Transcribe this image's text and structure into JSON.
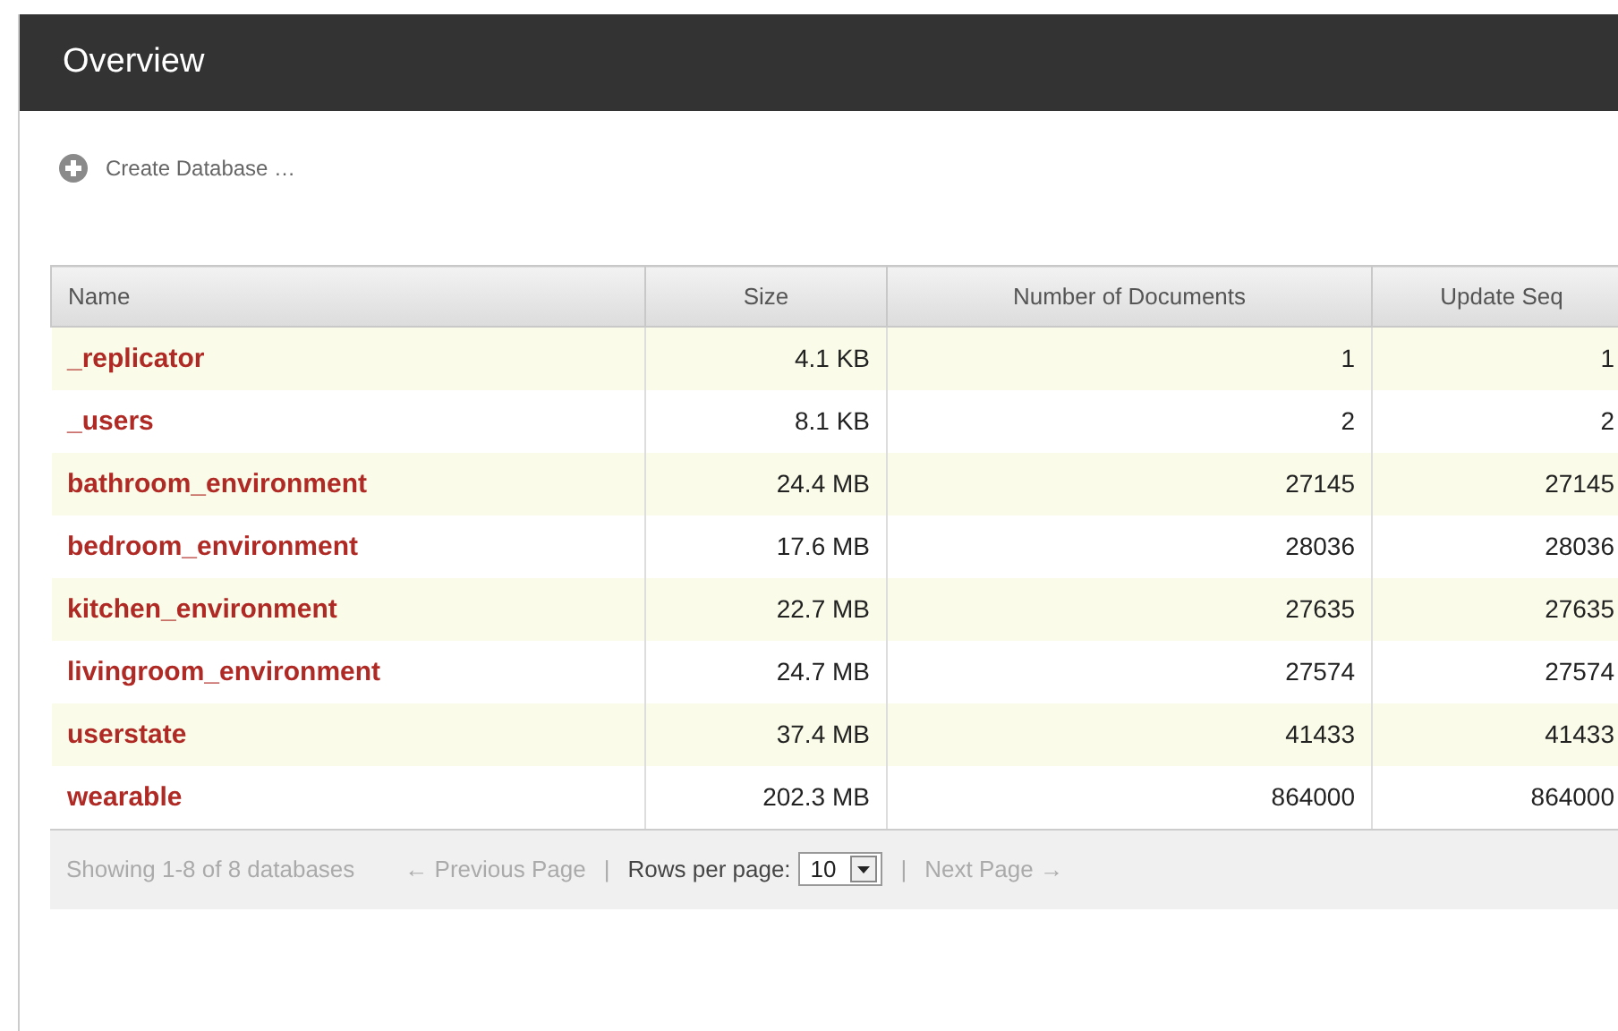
{
  "header": {
    "title": "Overview"
  },
  "create_link": {
    "label": "Create Database …"
  },
  "table": {
    "columns": [
      "Name",
      "Size",
      "Number of Documents",
      "Update Seq"
    ],
    "rows": [
      {
        "name": "_replicator",
        "size": "4.1 KB",
        "docs": "1",
        "seq": "1"
      },
      {
        "name": "_users",
        "size": "8.1 KB",
        "docs": "2",
        "seq": "2"
      },
      {
        "name": "bathroom_environment",
        "size": "24.4 MB",
        "docs": "27145",
        "seq": "27145"
      },
      {
        "name": "bedroom_environment",
        "size": "17.6 MB",
        "docs": "28036",
        "seq": "28036"
      },
      {
        "name": "kitchen_environment",
        "size": "22.7 MB",
        "docs": "27635",
        "seq": "27635"
      },
      {
        "name": "livingroom_environment",
        "size": "24.7 MB",
        "docs": "27574",
        "seq": "27574"
      },
      {
        "name": "userstate",
        "size": "37.4 MB",
        "docs": "41433",
        "seq": "41433"
      },
      {
        "name": "wearable",
        "size": "202.3 MB",
        "docs": "864000",
        "seq": "864000"
      }
    ]
  },
  "footer": {
    "summary": "Showing 1-8 of 8 databases",
    "previous": "← Previous Page",
    "separator_1": "|",
    "rows_label": "Rows per page:",
    "rows_value": "10",
    "separator_2": "|",
    "next": "Next Page →"
  }
}
